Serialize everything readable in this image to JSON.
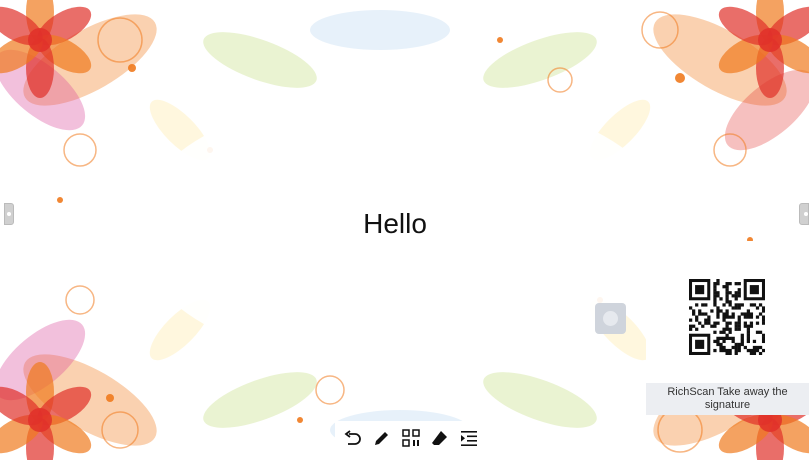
{
  "canvas": {
    "text": "Hello",
    "background_palette": {
      "orange": "#f07a1e",
      "red": "#e0302a",
      "pink": "#d94a9a",
      "green": "#b8d86a",
      "blue": "#9ec8ec",
      "cream": "#fff2c8"
    }
  },
  "qr_panel": {
    "caption": "RichScan Take away the signature"
  },
  "toolbar": {
    "tools": [
      {
        "icon": "undo-icon"
      },
      {
        "icon": "pen-icon"
      },
      {
        "icon": "qr-scan-icon"
      },
      {
        "icon": "eraser-icon"
      },
      {
        "icon": "menu-icon"
      }
    ]
  }
}
